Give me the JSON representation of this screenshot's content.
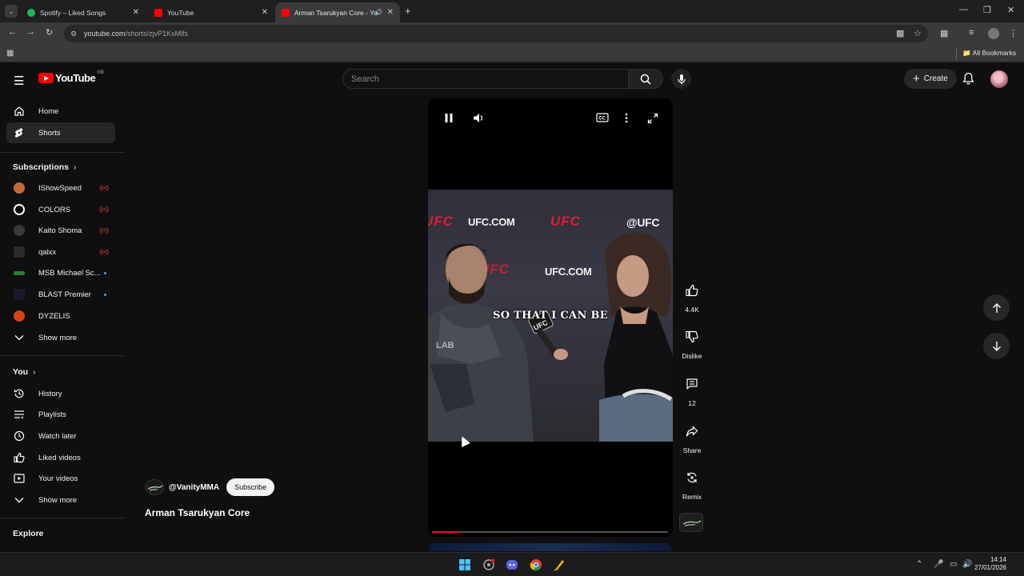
{
  "browser": {
    "tabs": [
      {
        "title": "Spotify – Liked Songs",
        "favicon_color": "#1db954"
      },
      {
        "title": "YouTube",
        "favicon_color": "#ff0000"
      },
      {
        "title": "Arman Tsarukyan Core - Yo",
        "favicon_color": "#ff0000",
        "active": true
      }
    ],
    "url_host": "youtube.com",
    "url_path": "/shorts/zjvP1KxMlfs",
    "bookmarks_label": "All Bookmarks"
  },
  "youtube": {
    "logo_text": "YouTube",
    "country_code": "GB",
    "search_placeholder": "Search",
    "create_label": "Create"
  },
  "sidebar": {
    "main": [
      {
        "label": "Home",
        "icon": "home-icon"
      },
      {
        "label": "Shorts",
        "icon": "shorts-icon",
        "selected": true
      }
    ],
    "subscriptions_header": "Subscriptions",
    "subscriptions": [
      {
        "label": "IShowSpeed",
        "status": "live",
        "color": "#c46a3a"
      },
      {
        "label": "COLORS",
        "status": "live",
        "color": "#ffffff"
      },
      {
        "label": "Kaito Shoma",
        "status": "live",
        "color": "#444444"
      },
      {
        "label": "qalxx",
        "status": "live",
        "color": "#333333"
      },
      {
        "label": "MSB Michael Sc...",
        "status": "new",
        "color": "#2e7d32"
      },
      {
        "label": "BLAST Premier",
        "status": "new",
        "color": "#222222"
      },
      {
        "label": "DYZELIS",
        "status": "",
        "color": "#d84315"
      }
    ],
    "show_more_1": "Show more",
    "you_header": "You",
    "you_items": [
      {
        "label": "History",
        "icon": "history-icon"
      },
      {
        "label": "Playlists",
        "icon": "playlists-icon"
      },
      {
        "label": "Watch later",
        "icon": "watch-later-icon"
      },
      {
        "label": "Liked videos",
        "icon": "liked-videos-icon"
      },
      {
        "label": "Your videos",
        "icon": "your-videos-icon"
      }
    ],
    "show_more_2": "Show more",
    "explore_header": "Explore"
  },
  "short": {
    "channel_handle": "@VanityMMA",
    "subscribe_label": "Subscribe",
    "title": "Arman Tsarukyan Core",
    "caption": "SO THAT I CAN BE",
    "progress": 0.12,
    "scene_text": {
      "url_top": "UFC.COM",
      "brand": "UFC",
      "handle": "@UFC",
      "url_mid": "UFC.COM"
    }
  },
  "actions": {
    "likes": "4.4K",
    "dislike_label": "Dislike",
    "comments": "12",
    "share_label": "Share",
    "remix_label": "Remix"
  },
  "taskbar": {
    "time": "14:14",
    "date": "27/01/2026"
  }
}
